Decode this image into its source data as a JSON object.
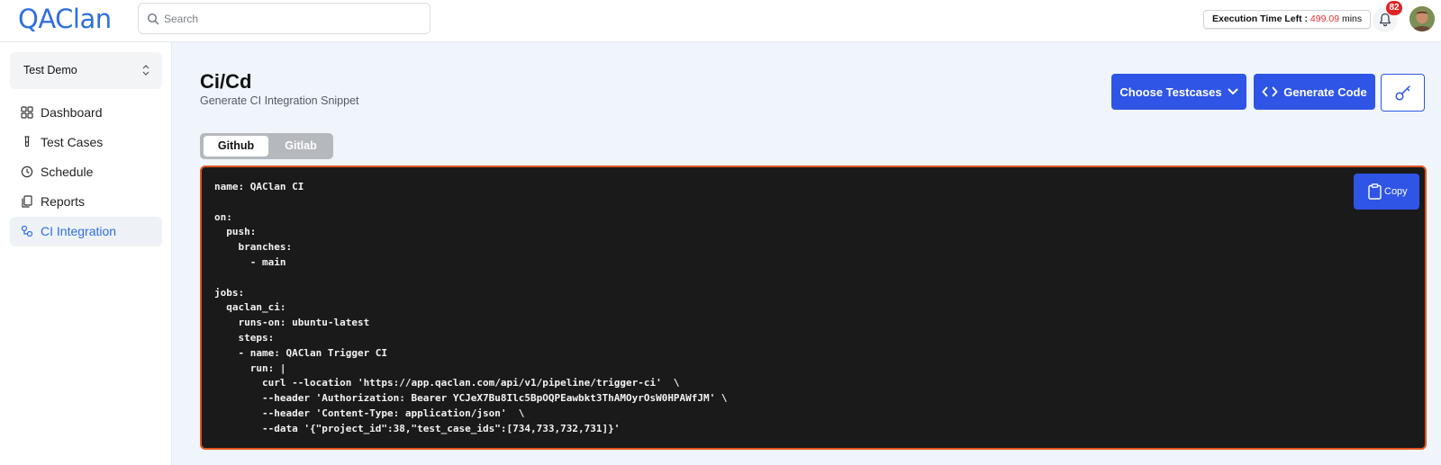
{
  "app": {
    "logo_text": "QAClan",
    "search_placeholder": "Search",
    "execution": {
      "label": "Execution Time Left :",
      "value": "499.09",
      "unit": "mins"
    },
    "notification_count": "82",
    "colors": {
      "accent": "#2f55e6",
      "link": "#2f6fe0",
      "code_border": "#e2571f",
      "badge": "#e02424"
    }
  },
  "sidebar": {
    "project_name": "Test Demo",
    "items": [
      {
        "label": "Dashboard",
        "icon": "dashboard-icon",
        "active": false
      },
      {
        "label": "Test Cases",
        "icon": "test-tube-icon",
        "active": false
      },
      {
        "label": "Schedule",
        "icon": "clock-icon",
        "active": false
      },
      {
        "label": "Reports",
        "icon": "reports-icon",
        "active": false
      },
      {
        "label": "CI Integration",
        "icon": "integration-icon",
        "active": true
      }
    ]
  },
  "main": {
    "title": "Ci/Cd",
    "subtitle": "Generate CI Integration Snippet",
    "choose_label": "Choose Testcases",
    "generate_label": "Generate Code",
    "tabs": [
      {
        "label": "Github",
        "selected": true
      },
      {
        "label": "Gitlab",
        "selected": false
      }
    ],
    "copy_label": "Copy",
    "code": "name: QAClan CI\n\non:\n  push:\n    branches:\n      - main\n\njobs:\n  qaclan_ci:\n    runs-on: ubuntu-latest\n    steps:\n    - name: QAClan Trigger CI\n      run: |\n        curl --location 'https://app.qaclan.com/api/v1/pipeline/trigger-ci'  \\\n        --header 'Authorization: Bearer YCJeX7Bu8Ilc5BpOQPEawbkt3ThAMOyrOsW0HPAWfJM' \\\n        --header 'Content-Type: application/json'  \\\n        --data '{\"project_id\":38,\"test_case_ids\":[734,733,732,731]}'"
  }
}
